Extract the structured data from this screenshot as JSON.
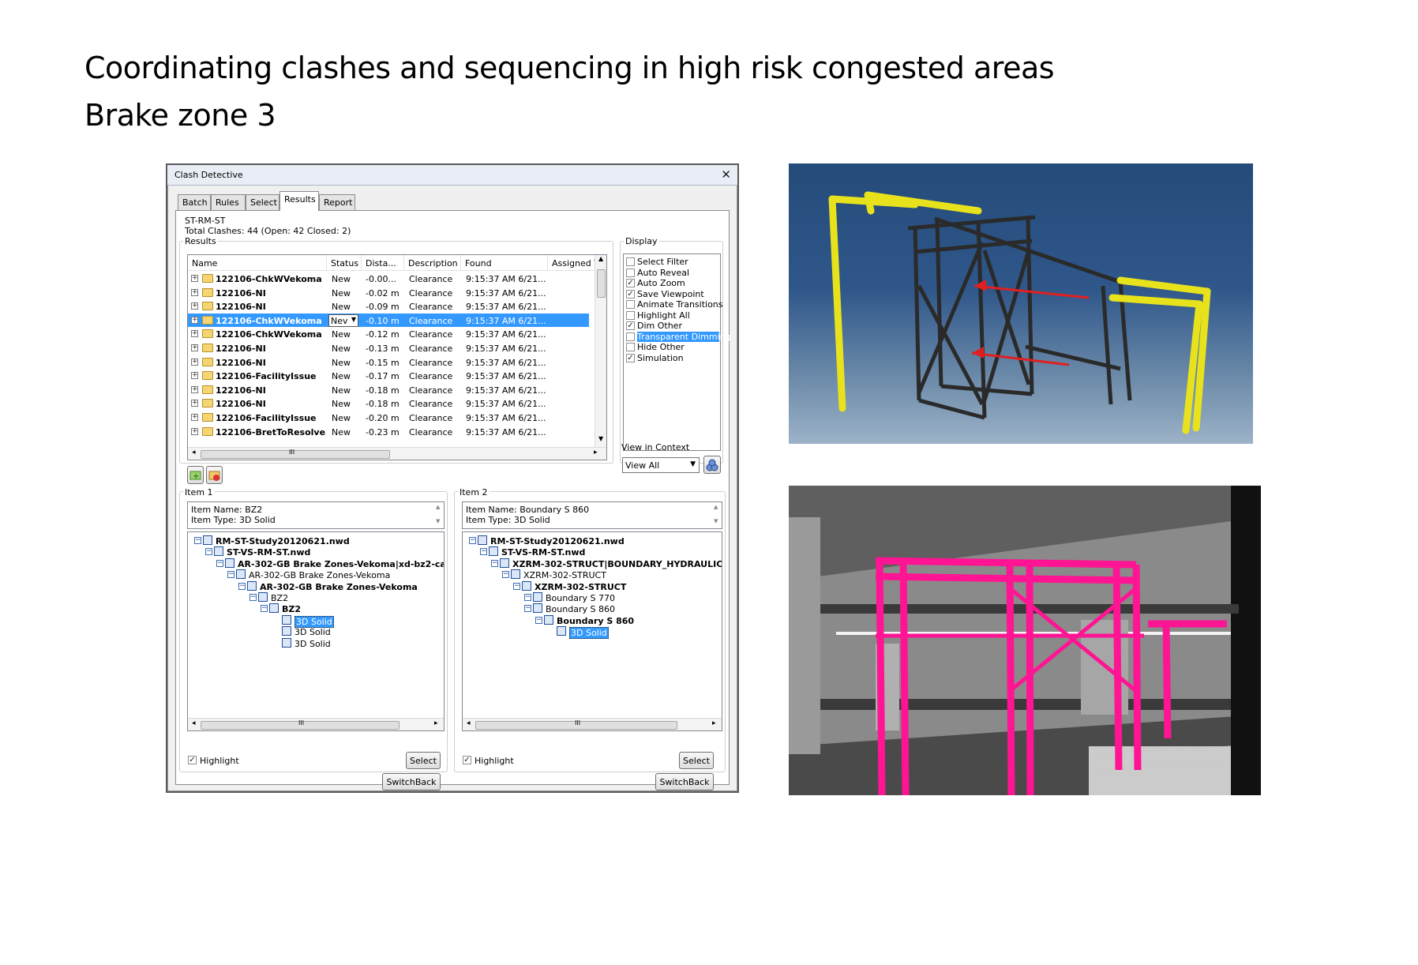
{
  "slide": {
    "title": "Coordinating clashes and sequencing in high risk congested areas",
    "subtitle": "Brake zone 3"
  },
  "dialog": {
    "title": "Clash Detective",
    "close": "✕",
    "tabs": [
      "Batch",
      "Rules",
      "Select",
      "Results",
      "Report"
    ],
    "active_tab": "Results",
    "test_name": "ST-RM-ST",
    "summary": "Total Clashes: 44 (Open: 42 Closed: 2)",
    "results_label": "Results",
    "columns": [
      "Name",
      "Status",
      "Dista...",
      "Description",
      "Found",
      "Assigned T"
    ],
    "rows": [
      {
        "name": "122106-ChkWVekoma",
        "status": "New",
        "dist": "-0.00...",
        "desc": "Clearance",
        "found": "9:15:37 AM 6/21..."
      },
      {
        "name": "122106-NI",
        "status": "New",
        "dist": "-0.02 m",
        "desc": "Clearance",
        "found": "9:15:37 AM 6/21..."
      },
      {
        "name": "122106-NI",
        "status": "New",
        "dist": "-0.09 m",
        "desc": "Clearance",
        "found": "9:15:37 AM 6/21..."
      },
      {
        "name": "122106-ChkWVekoma",
        "status": "Nev",
        "dist": "-0.10 m",
        "desc": "Clearance",
        "found": "9:15:37 AM 6/21..."
      },
      {
        "name": "122106-ChkWVekoma",
        "status": "New",
        "dist": "-0.12 m",
        "desc": "Clearance",
        "found": "9:15:37 AM 6/21..."
      },
      {
        "name": "122106-NI",
        "status": "New",
        "dist": "-0.13 m",
        "desc": "Clearance",
        "found": "9:15:37 AM 6/21..."
      },
      {
        "name": "122106-NI",
        "status": "New",
        "dist": "-0.15 m",
        "desc": "Clearance",
        "found": "9:15:37 AM 6/21..."
      },
      {
        "name": "122106-FacilityIssue",
        "status": "New",
        "dist": "-0.17 m",
        "desc": "Clearance",
        "found": "9:15:37 AM 6/21..."
      },
      {
        "name": "122106-NI",
        "status": "New",
        "dist": "-0.18 m",
        "desc": "Clearance",
        "found": "9:15:37 AM 6/21..."
      },
      {
        "name": "122106-NI",
        "status": "New",
        "dist": "-0.18 m",
        "desc": "Clearance",
        "found": "9:15:37 AM 6/21..."
      },
      {
        "name": "122106-FacilityIssue",
        "status": "New",
        "dist": "-0.20 m",
        "desc": "Clearance",
        "found": "9:15:37 AM 6/21..."
      },
      {
        "name": "122106-BretToResolve",
        "status": "New",
        "dist": "-0.23 m",
        "desc": "Clearance",
        "found": "9:15:37 AM 6/21..."
      }
    ],
    "selected_row": 3,
    "scroll_h_mark": "III",
    "display": {
      "label": "Display",
      "options": [
        {
          "label": "Select Filter",
          "checked": false
        },
        {
          "label": "Auto Reveal",
          "checked": false
        },
        {
          "label": "Auto Zoom",
          "checked": true
        },
        {
          "label": "Save Viewpoint",
          "checked": true
        },
        {
          "label": "Animate Transitions",
          "checked": false
        },
        {
          "label": "Highlight All",
          "checked": false
        },
        {
          "label": "Dim Other",
          "checked": true
        },
        {
          "label": "Transparent Dimming",
          "checked": false
        },
        {
          "label": "Hide Other",
          "checked": false
        },
        {
          "label": "Simulation",
          "checked": true
        }
      ],
      "highlighted": "Transparent Dimming",
      "context_label": "View in Context",
      "context_value": "View All"
    },
    "item1": {
      "label": "Item 1",
      "name_line": "Item Name: BZ2",
      "type_line": "Item Type: 3D Solid",
      "tree": [
        {
          "text": "RM-ST-Study20120621.nwd",
          "bold": true
        },
        {
          "text": "ST-VS-RM-ST.nwd",
          "bold": true
        },
        {
          "text": "AR-302-GB Brake Zones-Vekoma|xd-bz2-ca",
          "bold": true
        },
        {
          "text": "AR-302-GB Brake Zones-Vekoma",
          "bold": false
        },
        {
          "text": "AR-302-GB Brake Zones-Vekoma",
          "bold": true
        },
        {
          "text": "BZ2",
          "bold": false
        },
        {
          "text": "BZ2",
          "bold": true
        },
        {
          "text": "3D Solid",
          "bold": false
        },
        {
          "text": "3D Solid",
          "bold": false
        },
        {
          "text": "3D Solid",
          "bold": false
        }
      ],
      "highlight_label": "Highlight",
      "select_label": "Select",
      "switchback_label": "SwitchBack"
    },
    "item2": {
      "label": "Item 2",
      "name_line": "Item Name: Boundary S 860",
      "type_line": "Item Type: 3D Solid",
      "tree": [
        {
          "text": "RM-ST-Study20120621.nwd",
          "bold": true
        },
        {
          "text": "ST-VS-RM-ST.nwd",
          "bold": true
        },
        {
          "text": "XZRM-302-STRUCT|BOUNDARY_HYDRAULIC",
          "bold": true
        },
        {
          "text": "XZRM-302-STRUCT",
          "bold": false
        },
        {
          "text": "XZRM-302-STRUCT",
          "bold": true
        },
        {
          "text": "Boundary S 770",
          "bold": false
        },
        {
          "text": "Boundary S 860",
          "bold": false
        },
        {
          "text": "Boundary S 860",
          "bold": true
        },
        {
          "text": "3D Solid",
          "bold": false
        }
      ],
      "highlight_label": "Highlight",
      "select_label": "Select",
      "switchback_label": "SwitchBack"
    }
  },
  "colors": {
    "selection": "#3399ff",
    "yellow_rails": "#e8e21c",
    "frame": "#2b2b2b",
    "clash_arrows": "#e02020",
    "magenta_structure": "#ff1493"
  }
}
